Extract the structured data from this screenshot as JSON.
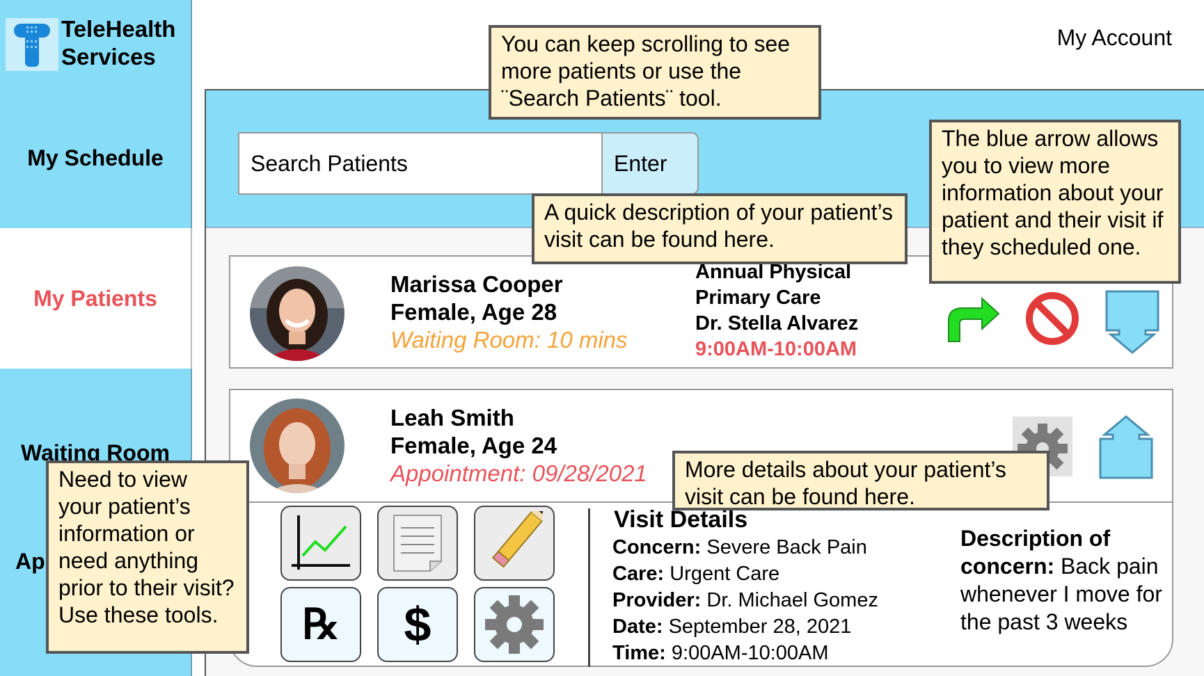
{
  "app": {
    "name_line1": "TeleHealth",
    "name_line2": "Services",
    "account_label": "My Account"
  },
  "sidebar": {
    "items": [
      {
        "label": "My Schedule"
      },
      {
        "label": "My Patients"
      },
      {
        "label": "Waiting Room"
      },
      {
        "label": "Ap"
      }
    ]
  },
  "search": {
    "placeholder": "Search Patients",
    "enter_label": "Enter"
  },
  "patients": [
    {
      "name": "Marissa Cooper",
      "demographics": "Female, Age 28",
      "status": "Waiting Room: 10 mins",
      "visit_type": "Annual Physical",
      "care": "Primary Care",
      "provider": "Dr. Stella Alvarez",
      "time": "9:00AM-10:00AM"
    },
    {
      "name": "Leah Smith",
      "demographics": "Female, Age 24",
      "status": "Appointment: 09/28/2021"
    }
  ],
  "tools": {
    "rx_label": "℞",
    "billing_label": "$"
  },
  "visit_details": {
    "heading": "Visit Details",
    "concern_label": "Concern:",
    "concern_value": " Severe Back Pain",
    "care_label": "Care:",
    "care_value": " Urgent Care",
    "provider_label": "Provider:",
    "provider_value": " Dr. Michael Gomez",
    "date_label": "Date:",
    "date_value": " September 28, 2021",
    "time_label": "Time:",
    "time_value": " 9:00AM-10:00AM",
    "description_label": "Description of concern:",
    "description_value": " Back pain whenever I move for the past 3 weeks"
  },
  "notes": {
    "scroll": "You can keep scrolling to see more patients or use the ¨Search Patients¨ tool.",
    "quick": "A quick description of your patient’s visit can be found here.",
    "arrow": "The blue arrow allows you to view more information about your patient and their visit if they scheduled one.",
    "details": "More details about your patient’s visit can be found here.",
    "tools": "Need to view your patient’s information or need anything prior to their visit? Use these tools."
  },
  "colors": {
    "sidebar_blue": "#87dcf8",
    "active_red": "#e8535a",
    "waiting_orange": "#f5a33a",
    "note_yellow": "#fff2cc",
    "accept_green": "#22dd22"
  },
  "icons": [
    "logo-icon",
    "accept-arrow-icon",
    "decline-icon",
    "expand-down-arrow-icon",
    "settings-gear-icon",
    "collapse-up-arrow-icon",
    "chart-icon",
    "notes-icon",
    "pencil-icon",
    "prescription-icon",
    "billing-icon",
    "gear-icon"
  ]
}
